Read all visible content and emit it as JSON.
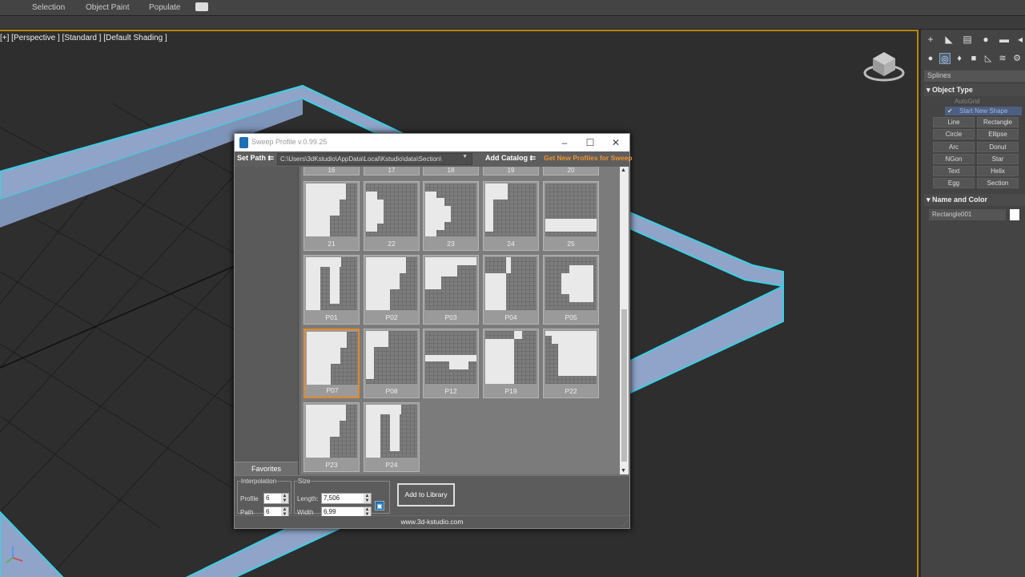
{
  "ribbon": {
    "tabs": [
      "Selection",
      "Object Paint",
      "Populate"
    ],
    "menu_icon": "gear-dropdown-icon"
  },
  "viewport": {
    "label": "[+] [Perspective ] [Standard ] [Default Shading ]"
  },
  "command_panel": {
    "category": "Splines",
    "object_type": {
      "header": "Object Type",
      "autogrid": "AutoGrid",
      "start_new_shape": "Start New Shape",
      "buttons": [
        "Line",
        "Rectangle",
        "Circle",
        "Ellipse",
        "Arc",
        "Donut",
        "NGon",
        "Star",
        "Text",
        "Helix",
        "Egg",
        "Section"
      ]
    },
    "name_and_color": {
      "header": "Name and Color",
      "name_value": "Rectangle001",
      "color": "#ffffff"
    }
  },
  "dialog": {
    "title": "Sweep Profile v.0.99.25",
    "toolbar": {
      "set_path": "Set Path",
      "path_value": "C:\\Users\\3dKstudio\\AppData\\Local\\Kstudio\\data\\Section\\",
      "add_catalog": "Add Catalog",
      "get_new": "Get New Profiles for Sweep"
    },
    "favorites_label": "Favorites",
    "top_row": [
      "16",
      "17",
      "18",
      "19",
      "20"
    ],
    "profiles": [
      {
        "label": "21",
        "shape": "crown"
      },
      {
        "label": "22",
        "shape": "step"
      },
      {
        "label": "23",
        "shape": "ogee"
      },
      {
        "label": "24",
        "shape": "narrow"
      },
      {
        "label": "25",
        "shape": "base"
      },
      {
        "label": "P01",
        "shape": "column"
      },
      {
        "label": "P02",
        "shape": "crown"
      },
      {
        "label": "P03",
        "shape": "cove"
      },
      {
        "label": "P04",
        "shape": "block"
      },
      {
        "label": "P05",
        "shape": "round"
      },
      {
        "label": "P07",
        "shape": "crown",
        "selected": true
      },
      {
        "label": "P08",
        "shape": "narrow"
      },
      {
        "label": "P12",
        "shape": "shelf"
      },
      {
        "label": "P19",
        "shape": "tall"
      },
      {
        "label": "P22",
        "shape": "stepped"
      },
      {
        "label": "P23",
        "shape": "crown"
      },
      {
        "label": "P24",
        "shape": "column"
      }
    ],
    "interpolation": {
      "legend": "Interpolation",
      "profile_label": "Profile",
      "profile_value": "6",
      "path_label": "Path",
      "path_value": "6"
    },
    "size": {
      "legend": "Size",
      "length_label": "Length:",
      "length_value": "7,506",
      "width_label": "Width",
      "width_value": "6,99"
    },
    "add_to_library": "Add to Library",
    "website": "www.3d-kstudio.com"
  }
}
